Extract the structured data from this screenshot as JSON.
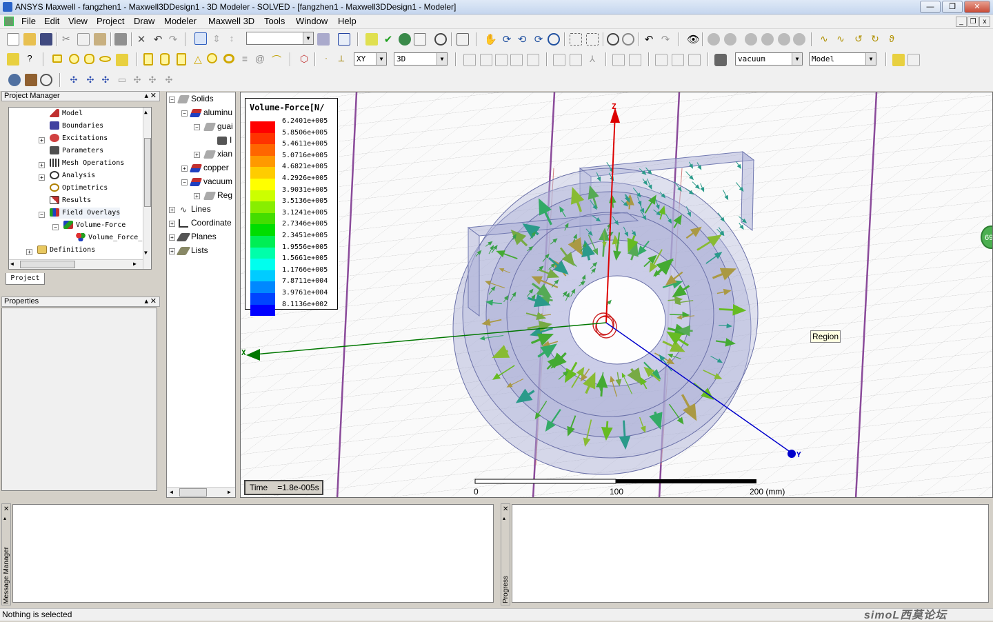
{
  "window": {
    "title": "ANSYS Maxwell - fangzhen1 - Maxwell3DDesign1 - 3D Modeler - SOLVED - [fangzhen1 - Maxwell3DDesign1 - Modeler]",
    "minimize": "—",
    "restore": "❐",
    "close": "✕"
  },
  "menu": [
    "File",
    "Edit",
    "View",
    "Project",
    "Draw",
    "Modeler",
    "Maxwell 3D",
    "Tools",
    "Window",
    "Help"
  ],
  "toolbar": {
    "plane_value": "XY",
    "view_value": "3D",
    "material_value": "vacuum",
    "model_value": "Model",
    "blank_combo": ""
  },
  "project_manager": {
    "header": "Project Manager",
    "tab": "Project",
    "items": [
      {
        "label": "Model",
        "icon": "model-icon",
        "color": "#c03030"
      },
      {
        "label": "Boundaries",
        "icon": "boundaries-icon",
        "color": "#4040a0"
      },
      {
        "label": "Excitations",
        "icon": "excitations-icon",
        "color": "#d03030"
      },
      {
        "label": "Parameters",
        "icon": "parameters-icon",
        "color": "#404040"
      },
      {
        "label": "Mesh Operations",
        "icon": "mesh-icon",
        "color": "#303030"
      },
      {
        "label": "Analysis",
        "icon": "analysis-icon",
        "color": "#303030"
      },
      {
        "label": "Optimetrics",
        "icon": "optimetrics-icon",
        "color": "#b08000"
      },
      {
        "label": "Results",
        "icon": "results-icon",
        "color": "#c03030"
      },
      {
        "label": "Field Overlays",
        "icon": "field-overlays-icon",
        "color": "#208020"
      },
      {
        "label": "Volume-Force",
        "icon": "volume-force-icon",
        "color": "#2040c0"
      },
      {
        "label": "Volume_Force_",
        "icon": "plot-icon",
        "color": "#c0a000"
      },
      {
        "label": "Definitions",
        "icon": "folder-icon",
        "color": "#e0c060"
      }
    ]
  },
  "properties": {
    "header": "Properties"
  },
  "model_tree": {
    "items": [
      {
        "label": "Solids"
      },
      {
        "label": "aluminu"
      },
      {
        "label": "guai"
      },
      {
        "label": "I"
      },
      {
        "label": "xian"
      },
      {
        "label": "copper"
      },
      {
        "label": "vacuum"
      },
      {
        "label": "Reg"
      },
      {
        "label": "Lines"
      },
      {
        "label": "Coordinate"
      },
      {
        "label": "Planes"
      },
      {
        "label": "Lists"
      }
    ]
  },
  "legend": {
    "title": "Volume-Force[N/",
    "entries": [
      {
        "value": "6.2401e+005",
        "color": "#ff0000"
      },
      {
        "value": "5.8506e+005",
        "color": "#ff3300"
      },
      {
        "value": "5.4611e+005",
        "color": "#ff6600"
      },
      {
        "value": "5.0716e+005",
        "color": "#ff9900"
      },
      {
        "value": "4.6821e+005",
        "color": "#ffcc00"
      },
      {
        "value": "4.2926e+005",
        "color": "#ffff00"
      },
      {
        "value": "3.9031e+005",
        "color": "#ccff00"
      },
      {
        "value": "3.5136e+005",
        "color": "#88ee00"
      },
      {
        "value": "3.1241e+005",
        "color": "#44dd00"
      },
      {
        "value": "2.7346e+005",
        "color": "#00dd00"
      },
      {
        "value": "2.3451e+005",
        "color": "#00ee55"
      },
      {
        "value": "1.9556e+005",
        "color": "#00ffaa"
      },
      {
        "value": "1.5661e+005",
        "color": "#00ffee"
      },
      {
        "value": "1.1766e+005",
        "color": "#00ccff"
      },
      {
        "value": "7.8711e+004",
        "color": "#0088ff"
      },
      {
        "value": "3.9761e+004",
        "color": "#0044ff"
      },
      {
        "value": "8.1136e+002",
        "color": "#0000ff"
      }
    ]
  },
  "viewport": {
    "time_label": "Time",
    "time_value": "=1.8e-005s",
    "region_label": "Region",
    "axis_x": "X",
    "axis_y": "Y",
    "axis_z": "Z",
    "scale_0": "0",
    "scale_100": "100",
    "scale_200": "200 (mm)",
    "badge": "69"
  },
  "panels": {
    "message_manager": "Message Manager",
    "progress": "Progress"
  },
  "status": {
    "text": "Nothing is selected",
    "watermark": "simoL西莫论坛"
  }
}
